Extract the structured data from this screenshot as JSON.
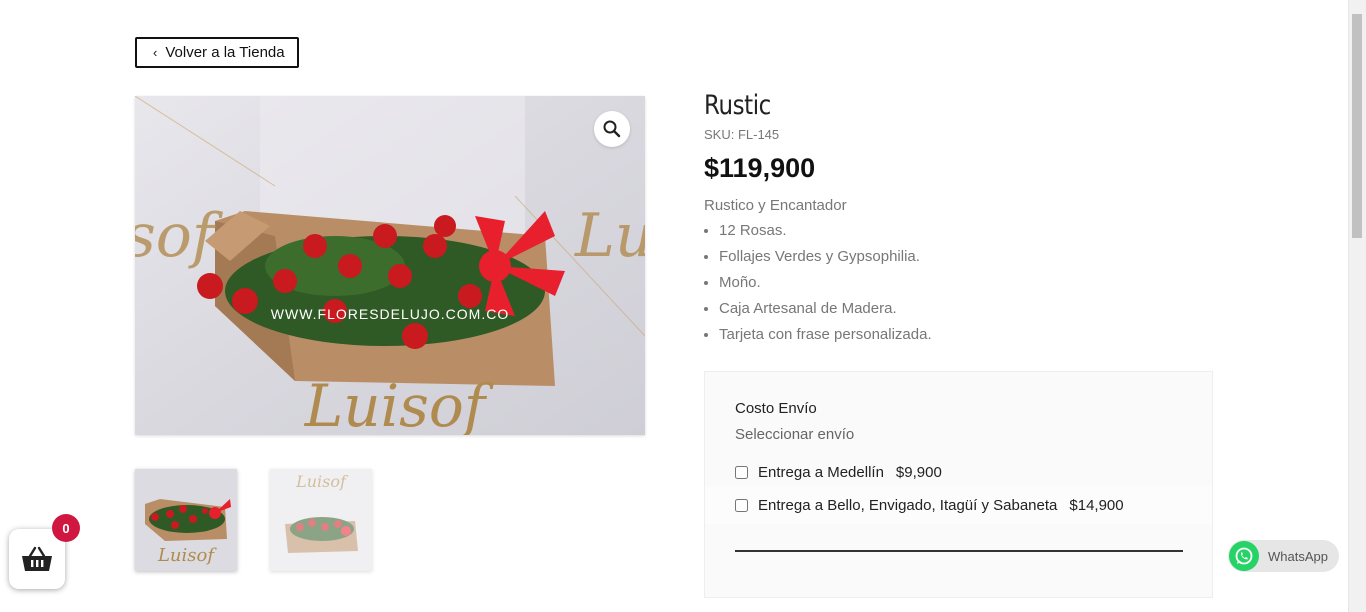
{
  "nav": {
    "back_label": "Volver a la Tienda"
  },
  "product": {
    "title": "Rustic",
    "sku": "SKU: FL-145",
    "price": "$119,900",
    "description": "Rustico y Encantador",
    "features": [
      "12 Rosas.",
      "Follajes Verdes y Gypsophilia.",
      "Moño.",
      "Caja Artesanal de Madera.",
      "Tarjeta con frase personalizada."
    ],
    "image_watermark": "WWW.FLORESDELUJO.COM.CO",
    "image_logo": "Luisof"
  },
  "shipping": {
    "title": "Costo Envío",
    "select_label": "Seleccionar envío",
    "options": [
      {
        "label": "Entrega a Medellín",
        "price": "$9,900"
      },
      {
        "label": "Entrega a Bello, Envigado, Itagüí y Sabaneta",
        "price": "$14,900"
      }
    ]
  },
  "cart": {
    "count": "0"
  },
  "whatsapp": {
    "label": "WhatsApp"
  },
  "colors": {
    "accent": "#d0173f",
    "whatsapp": "#25d366",
    "text": "#222222"
  }
}
